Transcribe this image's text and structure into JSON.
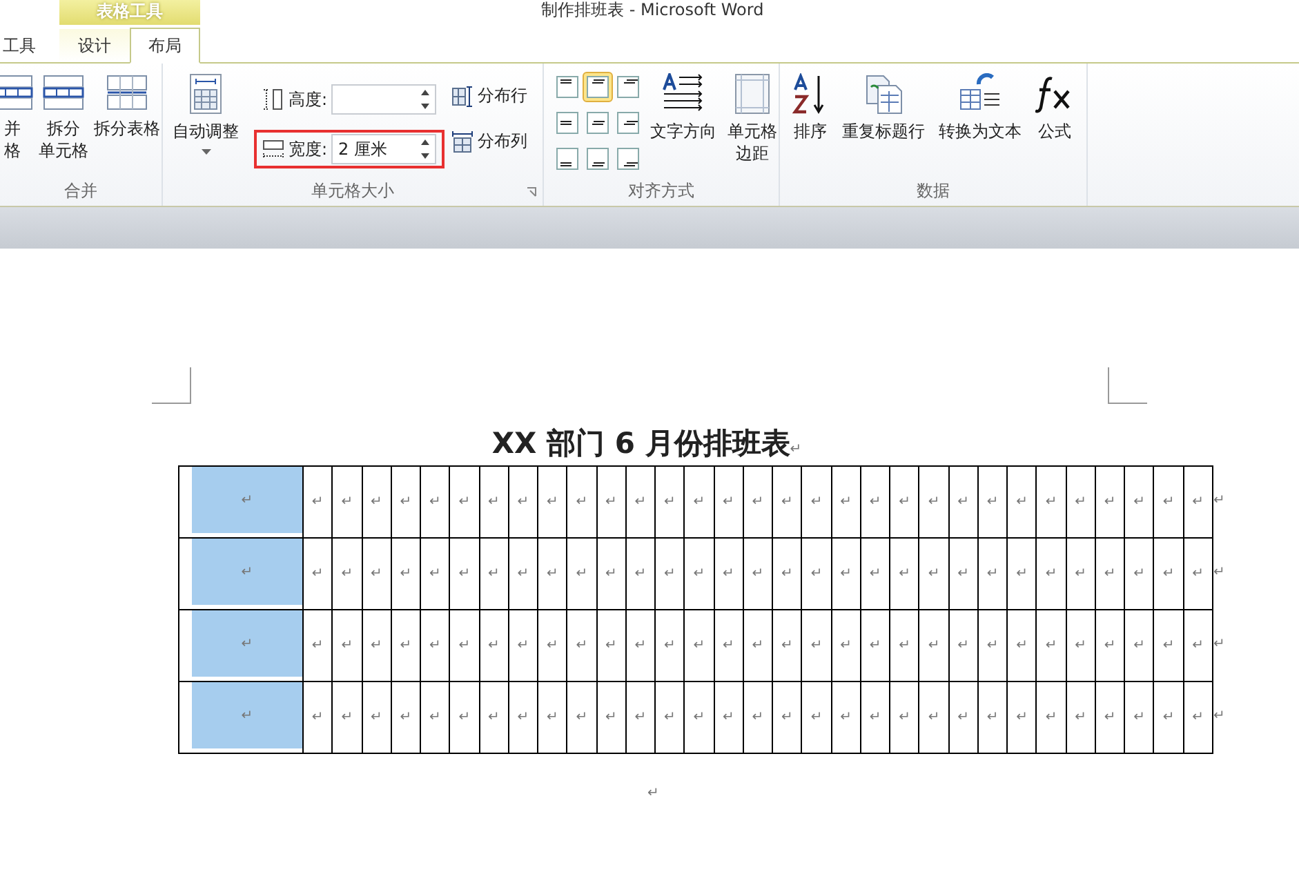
{
  "window": {
    "title": "制作排班表  -  Microsoft Word"
  },
  "context_tab_group": {
    "label": "表格工具"
  },
  "tabs": [
    {
      "label": "工具",
      "selected": false
    },
    {
      "label": "设计",
      "selected": false
    },
    {
      "label": "布局",
      "selected": true
    }
  ],
  "ribbon": {
    "merge": {
      "label": "合并",
      "buttons": [
        {
          "kind": "merge",
          "lines": [
            "并",
            "格"
          ]
        },
        {
          "kind": "split-cells",
          "lines": [
            "拆分",
            "单元格"
          ]
        },
        {
          "kind": "split-table",
          "lines": [
            "拆分表格"
          ]
        }
      ]
    },
    "cell_size": {
      "label": "单元格大小",
      "autofit": "自动调整",
      "height": {
        "label": "高度:"
      },
      "width": {
        "label": "宽度:",
        "value": "2 厘米",
        "highlighted": true
      },
      "distribute_rows": "分布行",
      "distribute_columns": "分布列"
    },
    "alignment": {
      "label": "对齐方式",
      "buttons": [
        {
          "kind": "top-left",
          "selected": false
        },
        {
          "kind": "top-center",
          "selected": true
        },
        {
          "kind": "top-right",
          "selected": false
        },
        {
          "kind": "middle-left",
          "selected": false
        },
        {
          "kind": "middle-center",
          "selected": false
        },
        {
          "kind": "middle-right",
          "selected": false
        },
        {
          "kind": "bottom-left",
          "selected": false
        },
        {
          "kind": "bottom-center",
          "selected": false
        },
        {
          "kind": "bottom-right",
          "selected": false
        }
      ],
      "text_direction": "文字方向",
      "cell_margins": [
        "单元格",
        "边距"
      ]
    },
    "data": {
      "label": "数据",
      "buttons": [
        {
          "kind": "sort",
          "label": "排序"
        },
        {
          "kind": "repeat-header",
          "label": "重复标题行"
        },
        {
          "kind": "convert",
          "label": "转换为文本"
        },
        {
          "kind": "formula",
          "label": "公式"
        }
      ]
    }
  },
  "document": {
    "heading": "XX 部门 6 月份排班表",
    "heading_mark": "↵",
    "rows": [
      {
        "selected": true,
        "first_mark": "↵",
        "cells": [
          "↵",
          "↵",
          "↵",
          "↵",
          "↵",
          "↵",
          "↵",
          "↵",
          "↵",
          "↵",
          "↵",
          "↵",
          "↵",
          "↵",
          "↵",
          "↵",
          "↵",
          "↵",
          "↵",
          "↵",
          "↵",
          "↵",
          "↵",
          "↵",
          "↵",
          "↵",
          "↵",
          "↵",
          "↵",
          "↵",
          "↵"
        ],
        "end_mark": "↵"
      },
      {
        "selected": true,
        "first_mark": "↵",
        "cells": [
          "↵",
          "↵",
          "↵",
          "↵",
          "↵",
          "↵",
          "↵",
          "↵",
          "↵",
          "↵",
          "↵",
          "↵",
          "↵",
          "↵",
          "↵",
          "↵",
          "↵",
          "↵",
          "↵",
          "↵",
          "↵",
          "↵",
          "↵",
          "↵",
          "↵",
          "↵",
          "↵",
          "↵",
          "↵",
          "↵",
          "↵"
        ],
        "end_mark": "↵"
      },
      {
        "selected": true,
        "first_mark": "↵",
        "cells": [
          "↵",
          "↵",
          "↵",
          "↵",
          "↵",
          "↵",
          "↵",
          "↵",
          "↵",
          "↵",
          "↵",
          "↵",
          "↵",
          "↵",
          "↵",
          "↵",
          "↵",
          "↵",
          "↵",
          "↵",
          "↵",
          "↵",
          "↵",
          "↵",
          "↵",
          "↵",
          "↵",
          "↵",
          "↵",
          "↵",
          "↵"
        ],
        "end_mark": "↵"
      },
      {
        "selected": true,
        "first_mark": "↵",
        "cells": [
          "↵",
          "↵",
          "↵",
          "↵",
          "↵",
          "↵",
          "↵",
          "↵",
          "↵",
          "↵",
          "↵",
          "↵",
          "↵",
          "↵",
          "↵",
          "↵",
          "↵",
          "↵",
          "↵",
          "↵",
          "↵",
          "↵",
          "↵",
          "↵",
          "↵",
          "↵",
          "↵",
          "↵",
          "↵",
          "↵",
          "↵"
        ],
        "end_mark": "↵"
      }
    ],
    "trailing_mark": "↵"
  }
}
